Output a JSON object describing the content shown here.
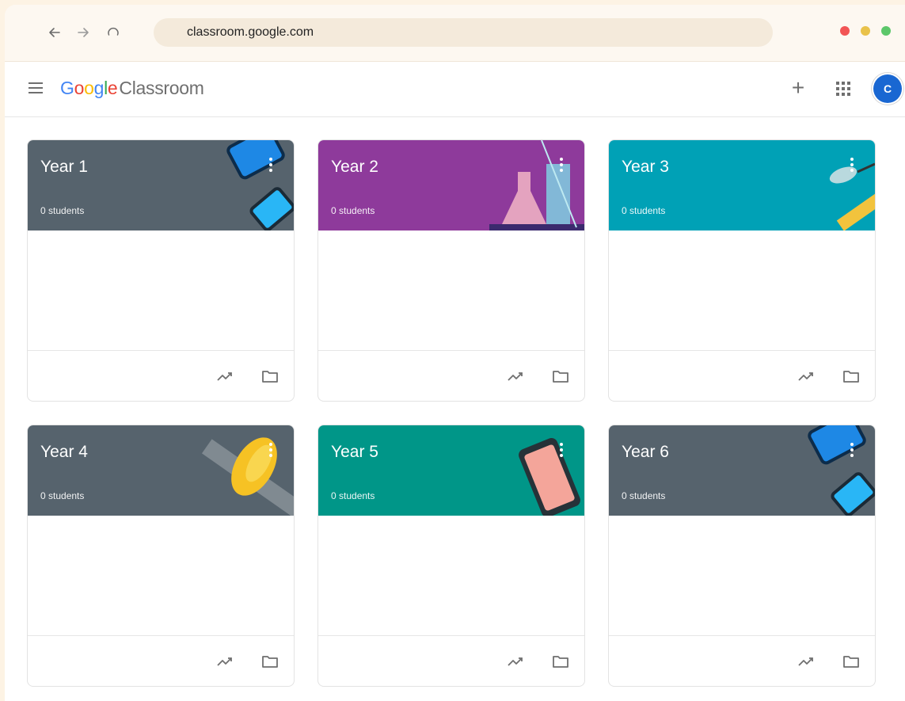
{
  "browser": {
    "url": "classroom.google.com",
    "back_icon": "arrow-left-icon",
    "forward_icon": "arrow-right-icon",
    "reload_icon": "reload-icon",
    "window_dots": [
      "#f25555",
      "#e9c24a",
      "#5cc76a"
    ]
  },
  "header": {
    "logo_google": "Google",
    "logo_product": "Classroom",
    "menu_icon": "hamburger-icon",
    "add_icon": "plus-icon",
    "apps_icon": "apps-grid-icon",
    "avatar_initial": "C"
  },
  "classes": [
    {
      "title": "Year 1",
      "subtitle": "0 students",
      "color": "#56636d",
      "art": "tablet-devices"
    },
    {
      "title": "Year 2",
      "subtitle": "0 students",
      "color": "#8e3a9b",
      "art": "chemistry-flask"
    },
    {
      "title": "Year 3",
      "subtitle": "0 students",
      "color": "#00a1b6",
      "art": "leaf-ruler"
    },
    {
      "title": "Year 4",
      "subtitle": "0 students",
      "color": "#56636d",
      "art": "yellow-gear"
    },
    {
      "title": "Year 5",
      "subtitle": "0 students",
      "color": "#009688",
      "art": "phone-game"
    },
    {
      "title": "Year 6",
      "subtitle": "0 students",
      "color": "#56636d",
      "art": "tablet-devices"
    }
  ],
  "card_actions": {
    "grades_icon": "trending-up-icon",
    "folder_icon": "folder-icon"
  }
}
